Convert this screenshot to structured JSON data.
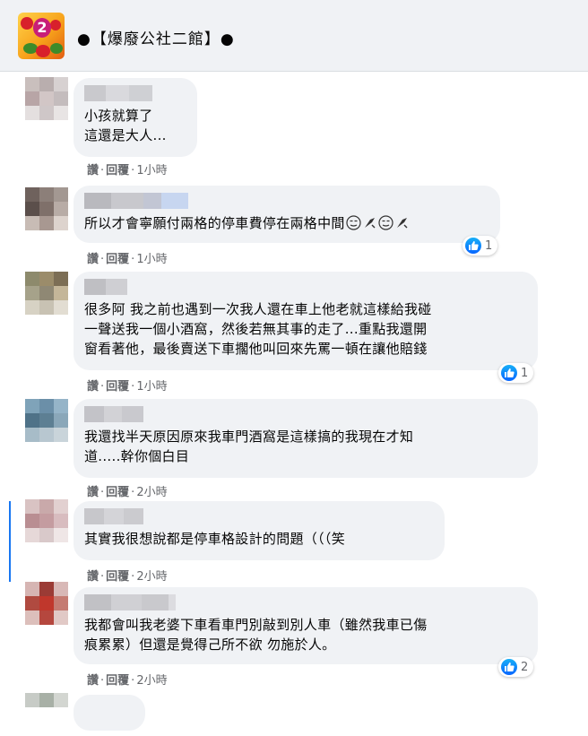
{
  "header": {
    "group_name": "●【爆廢公社二館】●",
    "avatar_badge": "2"
  },
  "comments": [
    {
      "text": "小孩就算了\n這還是大人...",
      "read": "讚",
      "reply": "回覆",
      "time": "1小時",
      "reaction_count": ""
    },
    {
      "text": "所以才會寧願付兩格的停車費停在兩格中間",
      "emojis": [
        "smirk-face-icon",
        "sweat-drop-icon",
        "smirk-face-icon",
        "sweat-drop-icon"
      ],
      "read": "讚",
      "reply": "回覆",
      "time": "1小時",
      "reaction_count": "1"
    },
    {
      "text": "很多阿 我之前也遇到一次我人還在車上他老就這樣給我碰\n一聲送我一個小酒窩，然後若無其事的走了...重點我還開\n窗看著他，最後賣送下車擱他叫回來先罵一頓在讓他賠錢",
      "read": "讚",
      "reply": "回覆",
      "time": "1小時",
      "reaction_count": "1"
    },
    {
      "text": "我還找半天原因原來我車門酒窩是這樣搞的我現在才知\n道.....幹你個白目",
      "read": "讚",
      "reply": "回覆",
      "time": "2小時",
      "reaction_count": ""
    },
    {
      "text": "其實我很想說都是停車格設計的問題（（（笑",
      "read": "讚",
      "reply": "回覆",
      "time": "2小時",
      "reaction_count": ""
    },
    {
      "text": "我都會叫我老婆下車看車門別敲到別人車（雖然我車已傷\n痕累累）但還是覺得己所不欲 勿施於人。",
      "read": "讚",
      "reply": "回覆",
      "time": "2小時",
      "reaction_count": "2"
    }
  ],
  "sep": "·",
  "colors": {
    "bubble": "#f0f2f5",
    "meta": "#65676b",
    "accent": "#1877f2"
  }
}
